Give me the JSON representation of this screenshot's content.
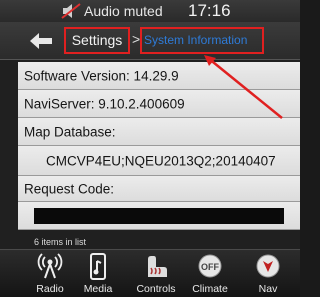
{
  "status_bar": {
    "audio_status": "Audio muted",
    "clock": "17:16"
  },
  "header": {
    "breadcrumb_parent": "Settings",
    "breadcrumb_separator": ">",
    "breadcrumb_current": "System Information"
  },
  "info_list": {
    "software_version": "Software Version: 14.29.9",
    "naviserver": "NaviServer: 9.10.2.400609",
    "map_database_label": "Map Database:",
    "map_database_value": "CMCVP4EU;NQEU2013Q2;20140407",
    "request_code_label": "Request Code:",
    "request_code_value_redacted": true
  },
  "items_count": "6 items in list",
  "bottom_nav": {
    "items": [
      {
        "label": "Radio",
        "icon": "radio-icon"
      },
      {
        "label": "Media",
        "icon": "media-icon"
      },
      {
        "label": "Controls",
        "icon": "controls-icon"
      },
      {
        "label": "Climate",
        "icon": "climate-icon",
        "badge": "OFF"
      },
      {
        "label": "Nav",
        "icon": "nav-icon"
      }
    ]
  },
  "colors": {
    "breadcrumb_current": "#2e7bd8",
    "highlight_box": "#e02020",
    "annotation_arrow": "#e02020",
    "list_background": "#e6e6e6"
  }
}
